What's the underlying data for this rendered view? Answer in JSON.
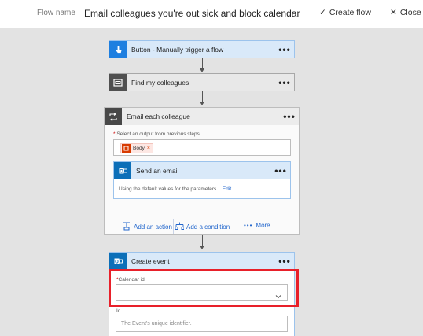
{
  "header": {
    "flow_name_label": "Flow name",
    "flow_title": "Email colleagues you're out sick and block calendar",
    "create_flow_label": "Create flow",
    "close_label": "Close"
  },
  "steps": {
    "trigger": {
      "title": "Button - Manually trigger a flow",
      "icon": "hand-pointer-icon",
      "color": "#1e7fe0"
    },
    "find": {
      "title": "Find my colleagues",
      "icon": "scope-icon",
      "color": "#505050"
    },
    "loop": {
      "title": "Email each colleague",
      "icon": "loop-icon",
      "color": "#484848",
      "select_label": "Select an output from previous steps",
      "token_label": "Body",
      "inner": {
        "title": "Send an email",
        "icon": "outlook-icon",
        "color": "#0c6fb8",
        "default_text": "Using the default values for the parameters.",
        "edit_label": "Edit"
      },
      "actions": {
        "add_action": "Add an action",
        "add_condition": "Add a condition",
        "more": "More"
      }
    },
    "create_event": {
      "title": "Create event",
      "icon": "outlook-icon",
      "color": "#0c6fb8",
      "calendar_label": "Calendar id",
      "calendar_value": "",
      "id_label": "Id",
      "id_placeholder": "The Event's unique identifier."
    }
  },
  "dots_label": "•••",
  "accent_color": "#2266cc",
  "highlight_color": "#e8202a"
}
